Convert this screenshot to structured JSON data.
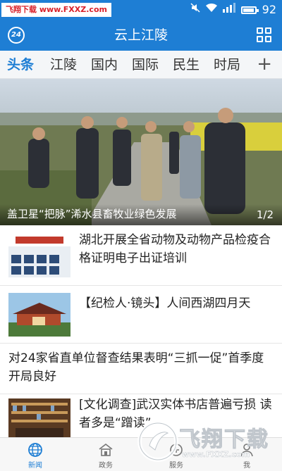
{
  "status_bar": {
    "watermark": "飞翔下载 www.FXXZ.com",
    "battery_level": 92,
    "battery_text": "92"
  },
  "header": {
    "title": "云上江陵",
    "logo_text": "24"
  },
  "channels": [
    {
      "label": "头条",
      "active": true
    },
    {
      "label": "江陵",
      "active": false
    },
    {
      "label": "国内",
      "active": false
    },
    {
      "label": "国际",
      "active": false
    },
    {
      "label": "民生",
      "active": false
    },
    {
      "label": "时局",
      "active": false
    }
  ],
  "channel_add_label": "+",
  "banner": {
    "caption": "盖卫星“把脉”浠水县畜牧业绿色发展",
    "pager": "1/2",
    "current_page": 1,
    "total_pages": 2
  },
  "news": [
    {
      "title": "湖北开展全省动物及动物产品检疫合格证明电子出证培训",
      "has_thumb": true
    },
    {
      "title": "【纪检人·镜头】人间西湖四月天",
      "has_thumb": true
    },
    {
      "title": "对24家省直单位督查结果表明“三抓一促”首季度开局良好",
      "has_thumb": false
    },
    {
      "title": "[文化调查]武汉实体书店普遍亏损 读者多是“蹭读”",
      "has_thumb": true
    }
  ],
  "bottom_nav": [
    {
      "label": "新闻",
      "icon": "globe-icon",
      "active": true
    },
    {
      "label": "政务",
      "icon": "government-icon",
      "active": false
    },
    {
      "label": "服务",
      "icon": "service-icon",
      "active": false
    },
    {
      "label": "我",
      "icon": "user-icon",
      "active": false
    }
  ],
  "watermark_bottom": {
    "text": "飞翔下载",
    "url": "www.FXXZ.com"
  },
  "colors": {
    "brand": "#1e7ed4",
    "active_channel": "#1e7ed4"
  }
}
